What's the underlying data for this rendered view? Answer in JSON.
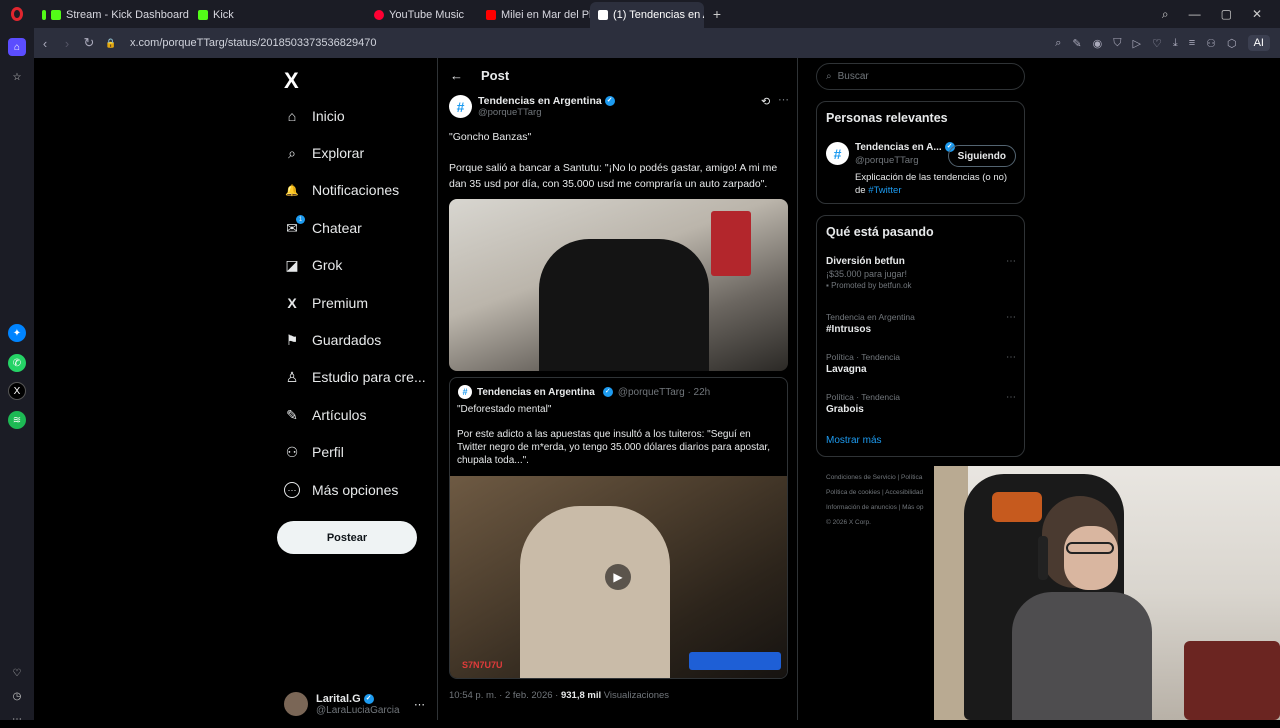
{
  "browser": {
    "tabs": [
      {
        "label": "Stream - Kick Dashboard",
        "color": "#53fc18",
        "active": false
      },
      {
        "label": "Kick",
        "color": "#53fc18",
        "active": false
      },
      {
        "label": "YouTube Music",
        "color": "#ff0033",
        "active": false
      },
      {
        "label": "Milei en Mar del Plata, Do",
        "color": "#ff0000",
        "active": false
      },
      {
        "label": "(1) Tendencias en Arg",
        "color": "#ffffff",
        "active": true
      }
    ],
    "url": "x.com/porqueTTarg/status/2018503373536829470",
    "ai_label": "AI"
  },
  "nav": {
    "logo": "X",
    "items": [
      {
        "label": "Inicio",
        "icon": "home-icon",
        "glyph": "⌂"
      },
      {
        "label": "Explorar",
        "icon": "search-icon",
        "glyph": "⌕"
      },
      {
        "label": "Notificaciones",
        "icon": "bell-icon",
        "glyph": "🔔"
      },
      {
        "label": "Chatear",
        "icon": "mail-icon",
        "glyph": "✉"
      },
      {
        "label": "Grok",
        "icon": "grok-icon",
        "glyph": "◪"
      },
      {
        "label": "Premium",
        "icon": "x-icon",
        "glyph": "X"
      },
      {
        "label": "Guardados",
        "icon": "bookmark-icon",
        "glyph": "⚑"
      },
      {
        "label": "Estudio para cre...",
        "icon": "studio-icon",
        "glyph": "♙"
      },
      {
        "label": "Artículos",
        "icon": "article-icon",
        "glyph": "✎"
      },
      {
        "label": "Perfil",
        "icon": "person-icon",
        "glyph": "⚇"
      },
      {
        "label": "Más opciones",
        "icon": "more-icon",
        "glyph": "⋯"
      }
    ],
    "chat_badge": "1",
    "post_button": "Postear",
    "account": {
      "name": "Larital.G",
      "handle": "@LaraLuciaGarcia"
    }
  },
  "post": {
    "header": "Post",
    "author_name": "Tendencias en Argentina",
    "author_handle": "@porqueTTarg",
    "line1": "\"Goncho Banzas\"",
    "line2": "Porque salió a bancar a Santutu: \"¡No lo podés gastar, amigo! A mi me dan 35 usd por día, con 35.000 usd me compraría un auto zarpado\".",
    "timestamp": "10:54 p. m. · 2 feb. 2026 ·",
    "views_count": "931,8 mil",
    "views_label": "Visualizaciones",
    "quote": {
      "author_name": "Tendencias en Argentina",
      "author_handle": "@porqueTTarg · 22h",
      "line1": "\"Deforestado mental\"",
      "line2": "Por este adicto a las apuestas que insultó a los tuiteros: \"Seguí en Twitter negro de m*erda, yo tengo 35.000 dólares diarios para apostar, chupala toda...\".",
      "video_brand": "S7N7U7U"
    }
  },
  "right": {
    "search_placeholder": "Buscar",
    "relevant": {
      "title": "Personas relevantes",
      "name": "Tendencias en A...",
      "handle": "@porqueTTarg",
      "follow_label": "Siguiendo",
      "bio": "Explicación de las tendencias (o no) de",
      "bio_link": "#Twitter"
    },
    "trends": {
      "title": "Qué está pasando",
      "items": [
        {
          "context": "",
          "title": "Diversión betfun",
          "sub": "¡$35.000 para jugar!",
          "promo": "Promoted by betfun.ok"
        },
        {
          "context": "Tendencia en Argentina",
          "title": "#Intrusos"
        },
        {
          "context": "Política · Tendencia",
          "title": "Lavagna"
        },
        {
          "context": "Política · Tendencia",
          "title": "Grabois"
        }
      ],
      "show_more": "Mostrar más"
    },
    "footer": [
      "Condiciones de Servicio | Política",
      "Política de cookies | Accesibilidad",
      "Información de anuncios | Más op",
      "© 2026 X Corp."
    ]
  }
}
